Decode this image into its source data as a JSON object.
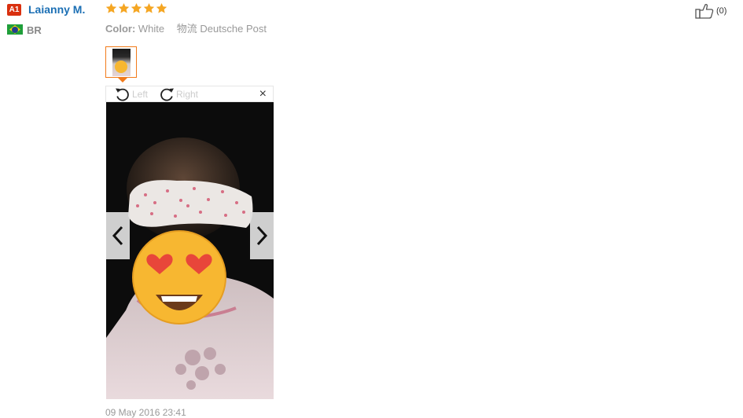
{
  "reviewer": {
    "badge": "A1",
    "name": "Laianny M.",
    "country": "BR",
    "flag_icon": "brazil-flag-icon"
  },
  "rating": {
    "stars": 5,
    "max": 5,
    "color": "#f5a623"
  },
  "meta": {
    "color_label": "Color:",
    "color_value": "White",
    "shipping_label": "物流",
    "shipping_value": "Deutsche Post"
  },
  "helpful": {
    "icon": "thumbs-up-icon",
    "count": "(0)"
  },
  "viewer": {
    "rotate_left": "Left",
    "rotate_right": "Right",
    "close": "×"
  },
  "date": "09 May 2016 23:41",
  "colors": {
    "accent": "#f27a1a",
    "link": "#1b6fb4",
    "badge": "#d9300f"
  }
}
